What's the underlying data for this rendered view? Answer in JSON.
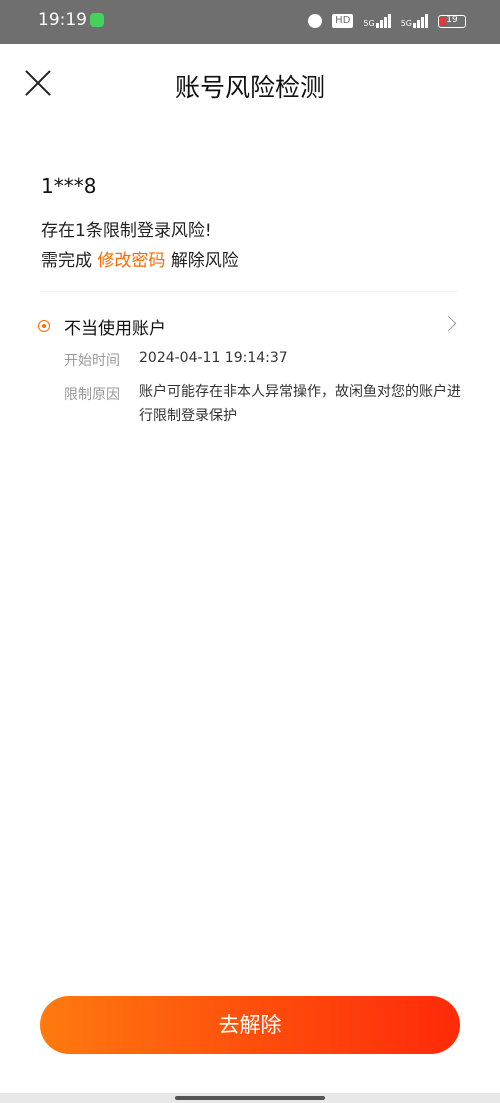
{
  "status_bar": {
    "time": "19:19",
    "battery_level": "19",
    "icons": [
      "wechat-icon",
      "alarm-icon",
      "hd-icon",
      "5g-signal-icon",
      "5g-signal-icon",
      "battery-icon"
    ]
  },
  "header": {
    "title": "账号风险检测",
    "close_icon": "close-icon"
  },
  "account": {
    "id": "1***8",
    "risk_text": "存在1条限制登录风险!",
    "action_prefix": "需完成",
    "action_link": "修改密码",
    "action_suffix": "解除风险"
  },
  "risk_items": [
    {
      "title": "不当使用账户",
      "start_label": "开始时间",
      "start_value": "2024-04-11 19:14:37",
      "reason_label": "限制原因",
      "reason_value": "账户可能存在非本人异常操作，故闲鱼对您的账户进行限制登录保护"
    }
  ],
  "footer": {
    "button_label": "去解除"
  },
  "colors": {
    "accent": "#ff6a00",
    "button_gradient_start": "#ff7a0f",
    "button_gradient_end": "#ff2a0a"
  }
}
